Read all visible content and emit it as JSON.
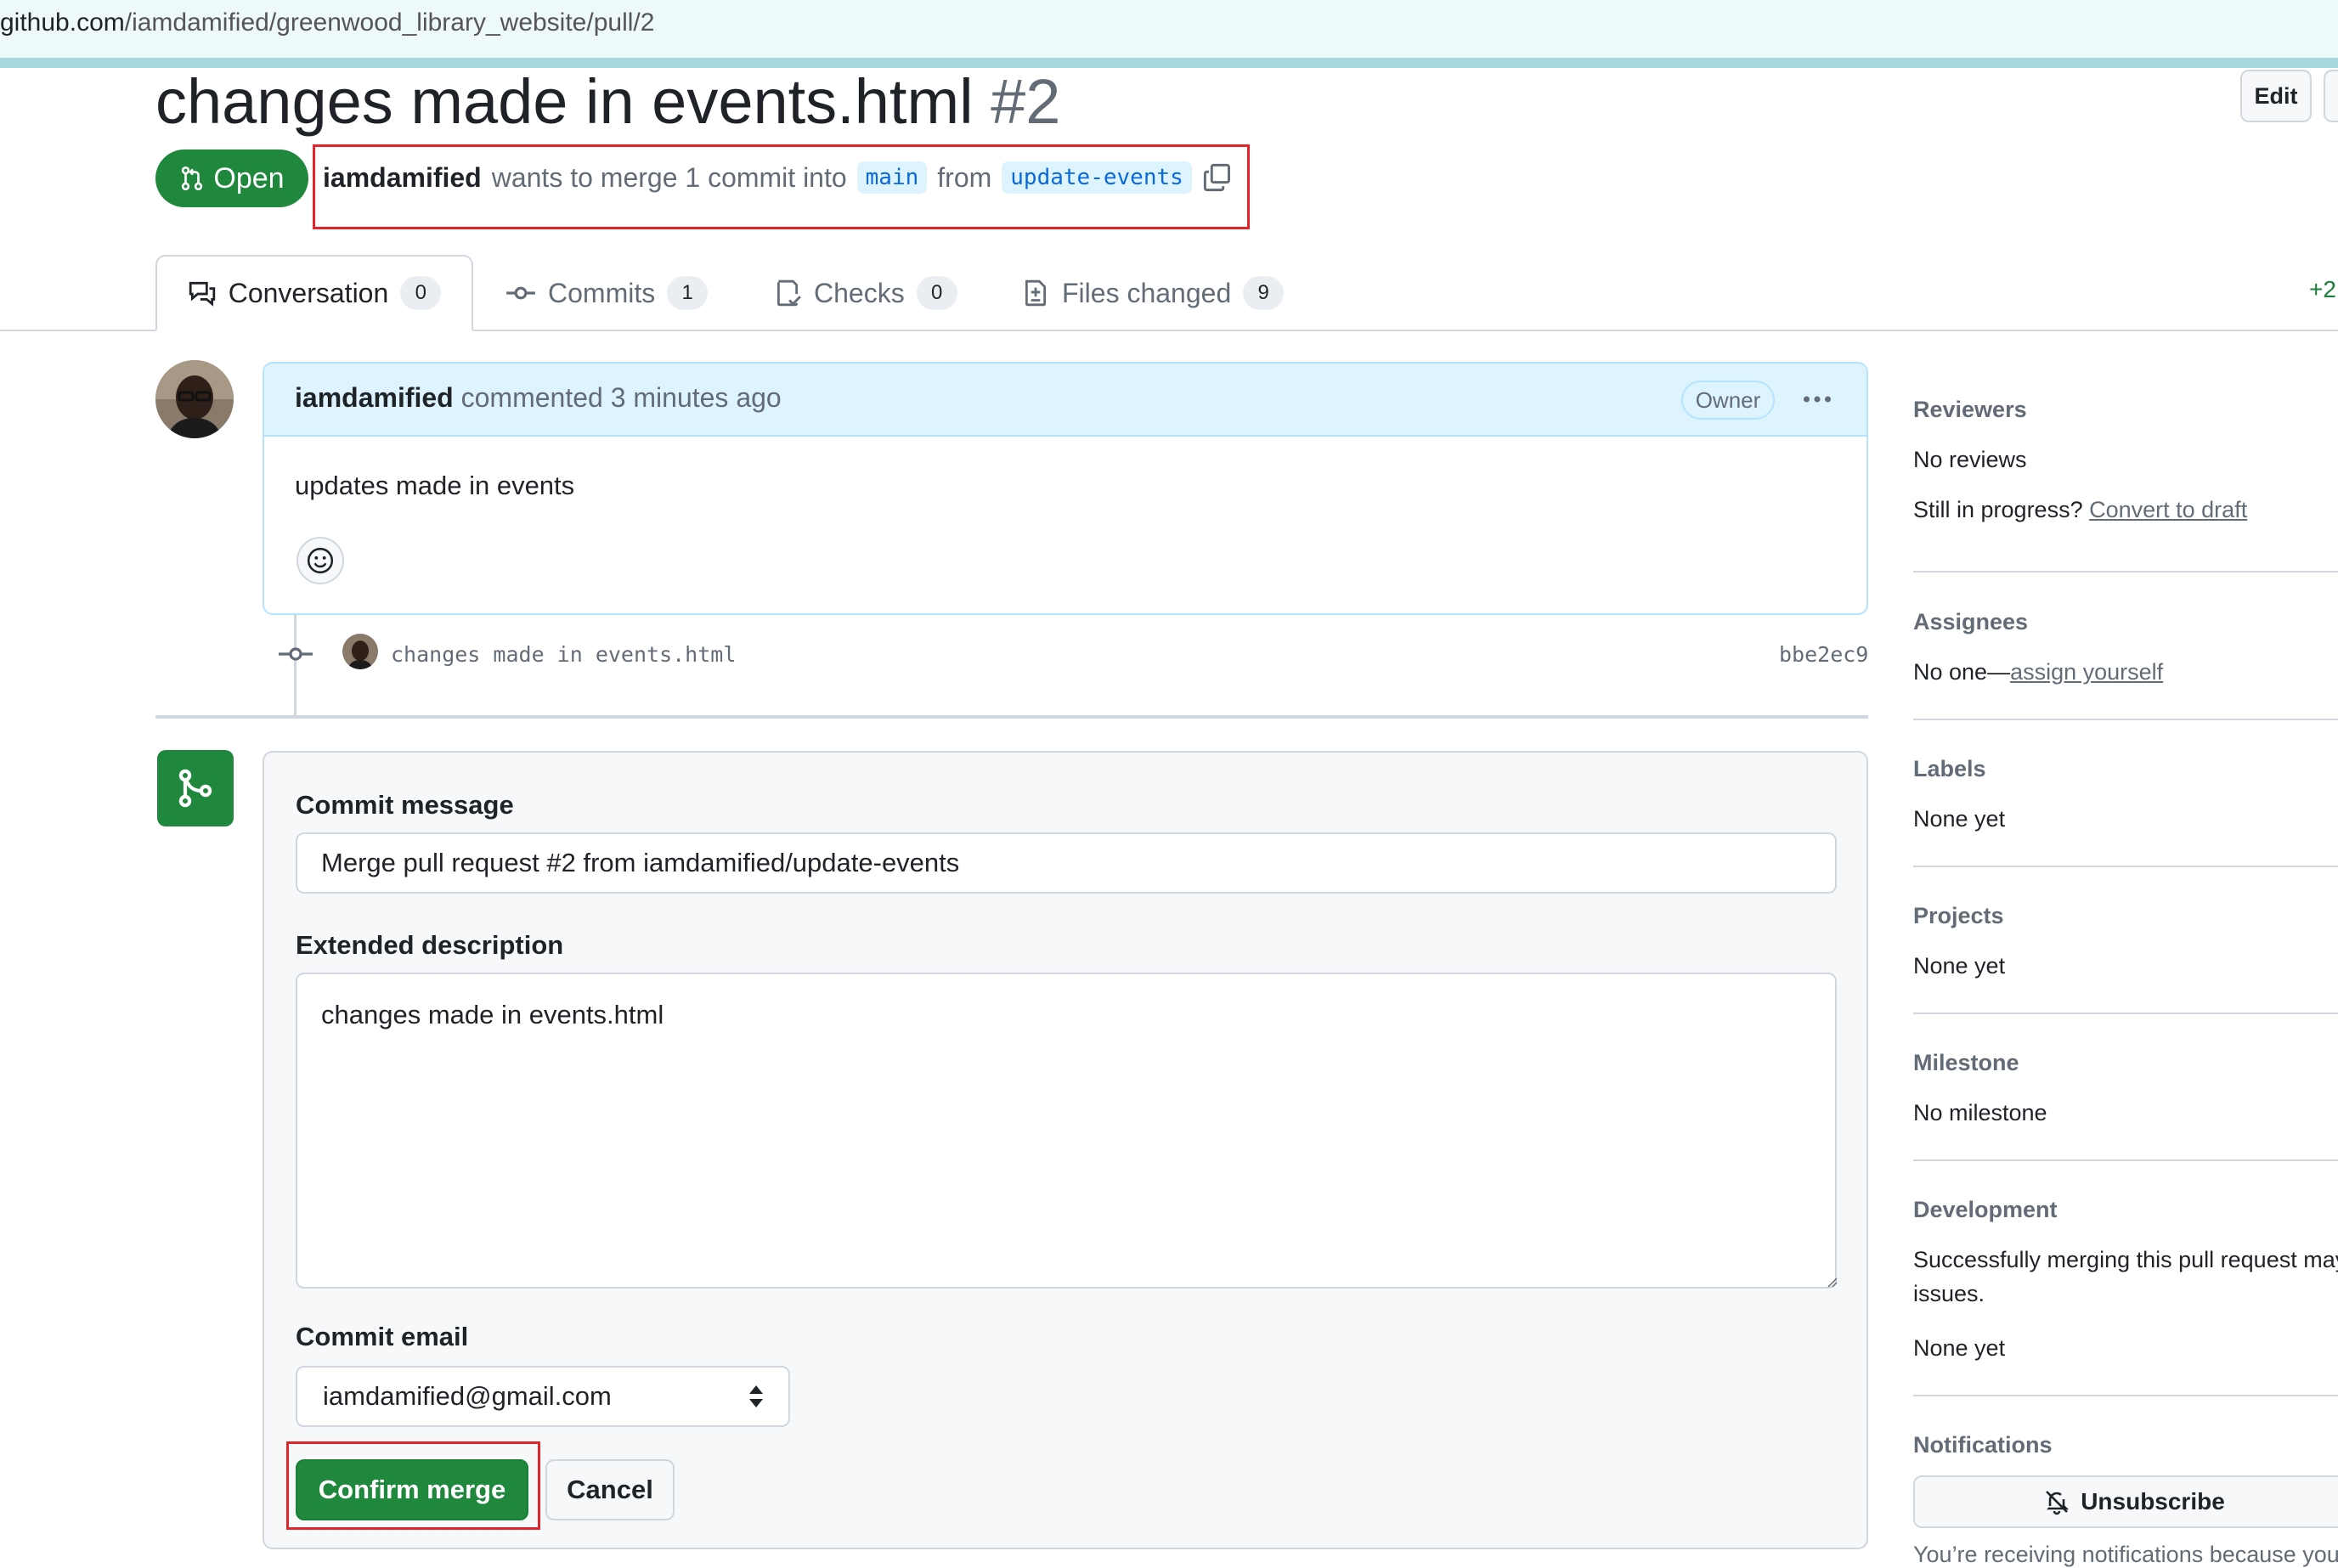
{
  "browser": {
    "url_host": "github.com",
    "url_path": "/iamdamified/greenwood_library_website/pull/2"
  },
  "pr": {
    "title": "changes made in events.html",
    "number": "#2",
    "edit_label": "Edit",
    "state": "Open",
    "author": "iamdamified",
    "merge_text_1": "wants to merge 1 commit into",
    "base_branch": "main",
    "merge_text_2": "from",
    "head_branch": "update-events"
  },
  "tabs": [
    {
      "label": "Conversation",
      "count": "0"
    },
    {
      "label": "Commits",
      "count": "1"
    },
    {
      "label": "Checks",
      "count": "0"
    },
    {
      "label": "Files changed",
      "count": "9"
    }
  ],
  "diffstat": "+2",
  "comment": {
    "author": "iamdamified",
    "action": "commented 3 minutes ago",
    "badge": "Owner",
    "body": "updates made in events"
  },
  "timeline_commit": {
    "message": "changes made in events.html",
    "sha": "bbe2ec9"
  },
  "merge_form": {
    "commit_message_label": "Commit message",
    "commit_message_value": "Merge pull request #2 from iamdamified/update-events",
    "extended_description_label": "Extended description",
    "extended_description_value": "changes made in events.html",
    "commit_email_label": "Commit email",
    "commit_email_value": "iamdamified@gmail.com",
    "confirm_label": "Confirm merge",
    "cancel_label": "Cancel"
  },
  "sidebar": {
    "reviewers": {
      "heading": "Reviewers",
      "value": "No reviews",
      "prompt": "Still in progress?",
      "link": "Convert to draft"
    },
    "assignees": {
      "heading": "Assignees",
      "value": "No one—",
      "link": "assign yourself"
    },
    "labels": {
      "heading": "Labels",
      "value": "None yet"
    },
    "projects": {
      "heading": "Projects",
      "value": "None yet"
    },
    "milestone": {
      "heading": "Milestone",
      "value": "No milestone"
    },
    "development": {
      "heading": "Development",
      "line1": "Successfully merging this pull request may",
      "line2": "issues.",
      "value": "None yet"
    },
    "notifications": {
      "heading": "Notifications",
      "button": "Unsubscribe",
      "note": "You’re receiving notifications because you"
    }
  },
  "colors": {
    "accent_green": "#1f883d",
    "link_blue": "#0969da",
    "highlight_red": "#e0242c"
  }
}
